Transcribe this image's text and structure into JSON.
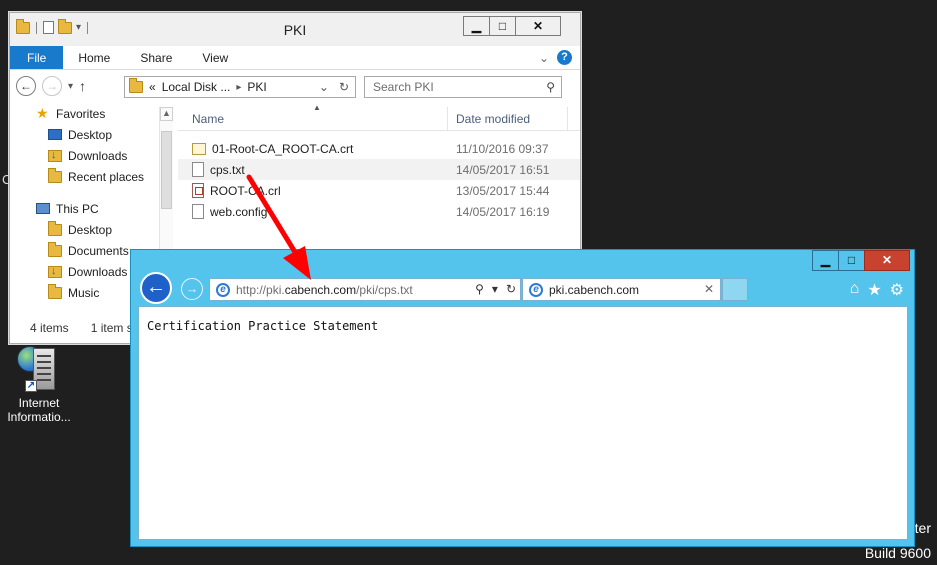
{
  "desktop": {
    "icon_label": "Internet Informatio...",
    "edge_text": "C",
    "watermark_line1": "ter",
    "watermark_line2": "Build 9600"
  },
  "explorer": {
    "title": "PKI",
    "window_controls": {
      "minimize": "▁",
      "maximize": "□",
      "close": "✕"
    },
    "ribbon_tabs": [
      "File",
      "Home",
      "Share",
      "View"
    ],
    "address_path": [
      "«",
      "Local Disk ...",
      "▸",
      "PKI"
    ],
    "search_placeholder": "Search PKI",
    "nav": {
      "favorites": "Favorites",
      "fav_items": [
        "Desktop",
        "Downloads",
        "Recent places"
      ],
      "this_pc": "This PC",
      "pc_items": [
        "Desktop",
        "Documents",
        "Downloads",
        "Music"
      ]
    },
    "columns": {
      "name": "Name",
      "date": "Date modified"
    },
    "files": [
      {
        "name": "01-Root-CA_ROOT-CA.crt",
        "date": "11/10/2016 09:37",
        "icon": "certificate-icon"
      },
      {
        "name": "cps.txt",
        "date": "14/05/2017 16:51",
        "icon": "text-file-icon"
      },
      {
        "name": "ROOT-CA.crl",
        "date": "13/05/2017 15:44",
        "icon": "crl-file-icon"
      },
      {
        "name": "web.config",
        "date": "14/05/2017 16:19",
        "icon": "config-file-icon"
      }
    ],
    "status": {
      "items": "4 items",
      "selected": "1 item s"
    }
  },
  "ie": {
    "window_controls": {
      "minimize": "▁",
      "maximize": "□",
      "close": "✕"
    },
    "address": {
      "prefix": "http://pki.",
      "host": "cabench.com",
      "path": "/pki/cps.txt"
    },
    "tab_title": "pki.cabench.com",
    "content": "Certification Practice Statement",
    "accent": "#54c4ec"
  },
  "annotation": {
    "arrow_color": "#ff0000"
  }
}
